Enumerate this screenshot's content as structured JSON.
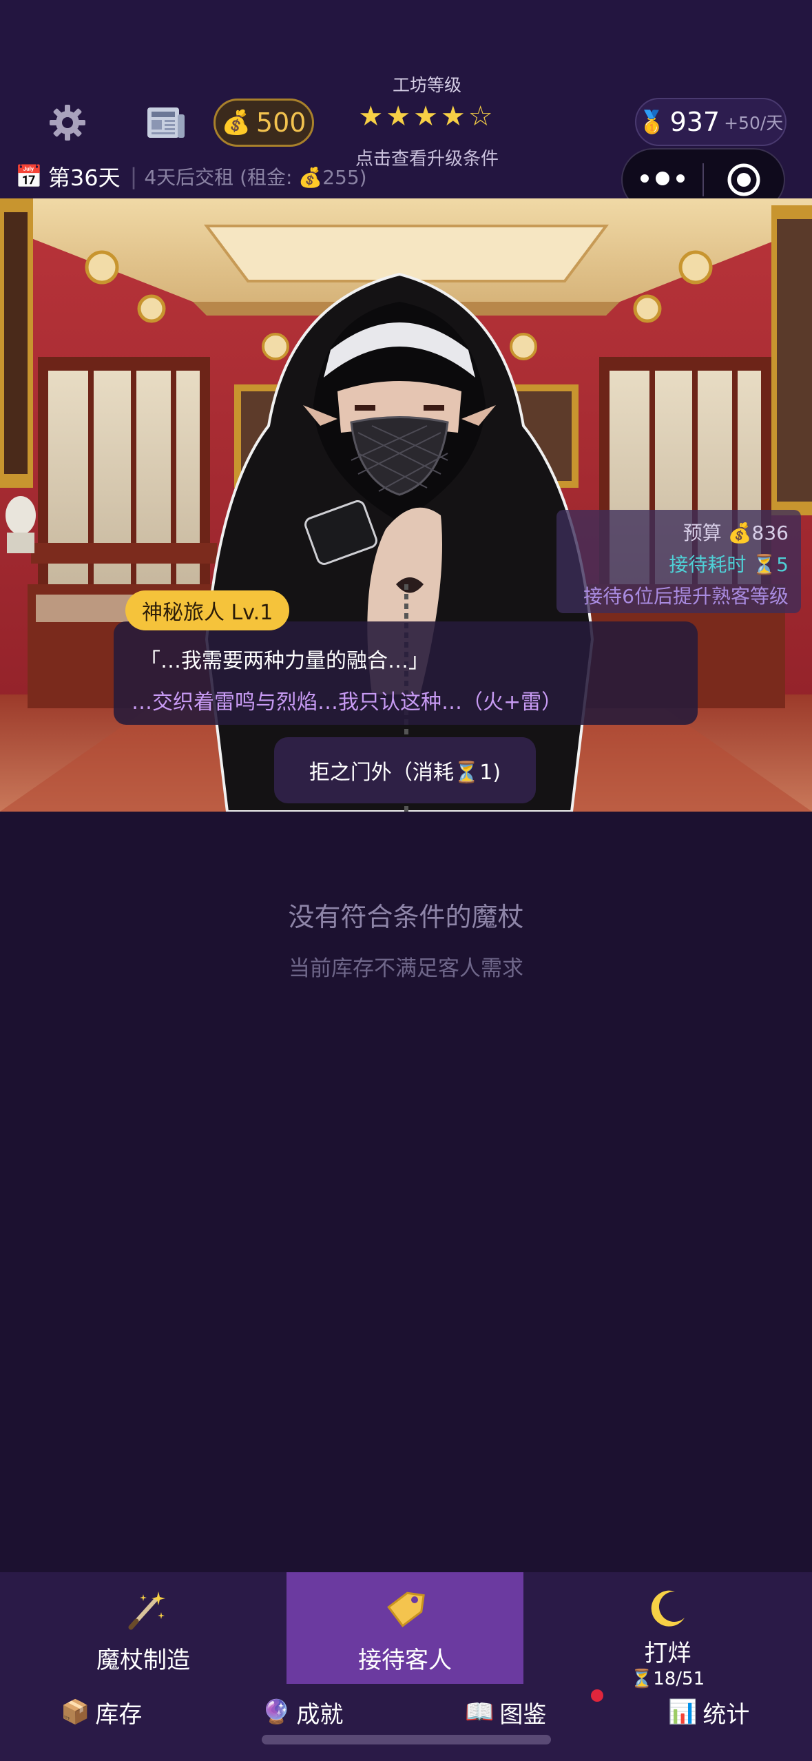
{
  "header": {
    "coins": "500",
    "coin_icon": "money-bag-icon",
    "level_title": "工坊等级",
    "stars": "★★★★☆",
    "star_rating": 4,
    "star_max": 5,
    "level_hint": "点击查看升级条件",
    "medal_value": "937",
    "medal_rate": "+50/天",
    "day": "第36天",
    "rent_info": "4天后交租 (租金: 💰255)"
  },
  "customer": {
    "name_level": "神秘旅人 Lv.1",
    "dialog_line1": "「…我需要两种力量的融合…」",
    "dialog_line2": "…交织着雷鸣与烈焰…我只认这种…（火+雷）",
    "budget": "预算 💰836",
    "service_time": "接待耗时 ⏳5",
    "loyalty_hint": "接待6位后提升熟客等级",
    "reject_button": "拒之门外（消耗⏳1)"
  },
  "empty_state": {
    "title": "没有符合条件的魔杖",
    "subtitle": "当前库存不满足客人需求"
  },
  "nav": {
    "tabs": [
      {
        "label": "魔杖制造",
        "icon": "magic-wand-icon"
      },
      {
        "label": "接待客人",
        "icon": "tag-icon"
      },
      {
        "label": "打烊",
        "icon": "crescent-moon-icon",
        "counter": "⏳18/51"
      }
    ],
    "active_tab": 1,
    "sub_items": [
      {
        "label": "库存",
        "icon": "box-icon"
      },
      {
        "label": "成就",
        "icon": "crystal-ball-icon"
      },
      {
        "label": "图鉴",
        "icon": "book-icon"
      },
      {
        "label": "统计",
        "icon": "bar-chart-icon"
      }
    ]
  },
  "colors": {
    "background": "#1c1130",
    "header": "#231540",
    "nav_bar": "#2a1a47",
    "active_tab": "#6b3aa0",
    "gold": "#f5c33b",
    "dialog_accent": "#c89bf4",
    "service_time": "#4fd0d6",
    "loyalty": "#a98be0"
  }
}
